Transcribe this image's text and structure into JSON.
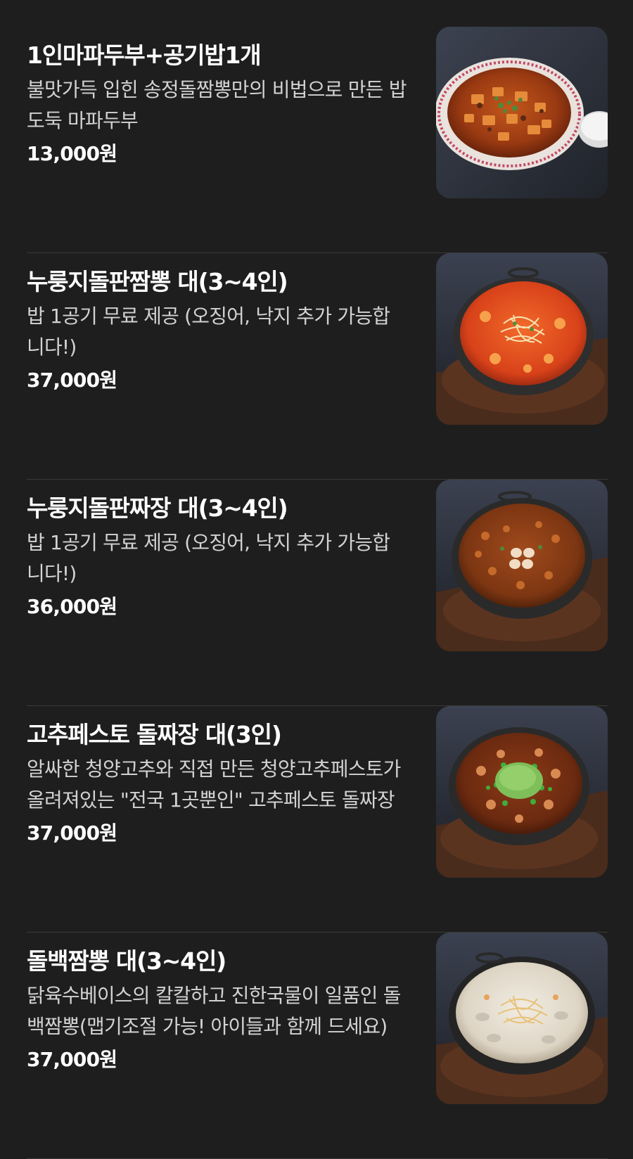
{
  "menu": {
    "items": [
      {
        "name": "1인마파두부+공기밥1개",
        "description": "불맛가득 입힌 송정돌짬뽕만의 비법으로 만든 밥도둑 마파두부",
        "price": "13,000원",
        "image": "mapo-tofu-photo"
      },
      {
        "name": "누룽지돌판짬뽕 대(3~4인)",
        "description": "밥 1공기 무료 제공 (오징어, 낙지 추가 가능합니다!)",
        "price": "37,000원",
        "image": "stone-pot-jjamppong-photo"
      },
      {
        "name": "누룽지돌판짜장 대(3~4인)",
        "description": "밥 1공기 무료 제공 (오징어, 낙지 추가 가능합니다!)",
        "price": "36,000원",
        "image": "stone-pot-jjajang-photo"
      },
      {
        "name": "고추페스토 돌짜장 대(3인)",
        "description": "알싸한 청양고추와 직접 만든 청양고추페스토가 올려져있는 \"전국 1곳뿐인\" 고추페스토 돌짜장",
        "price": "37,000원",
        "image": "pepper-pesto-jjajang-photo"
      },
      {
        "name": "돌백짬뽕 대(3~4인)",
        "description": "닭육수베이스의 칼칼하고 진한국물이 일품인 돌백짬뽕(맵기조절 가능! 아이들과 함께 드세요)",
        "price": "37,000원",
        "image": "white-jjamppong-photo"
      }
    ]
  }
}
